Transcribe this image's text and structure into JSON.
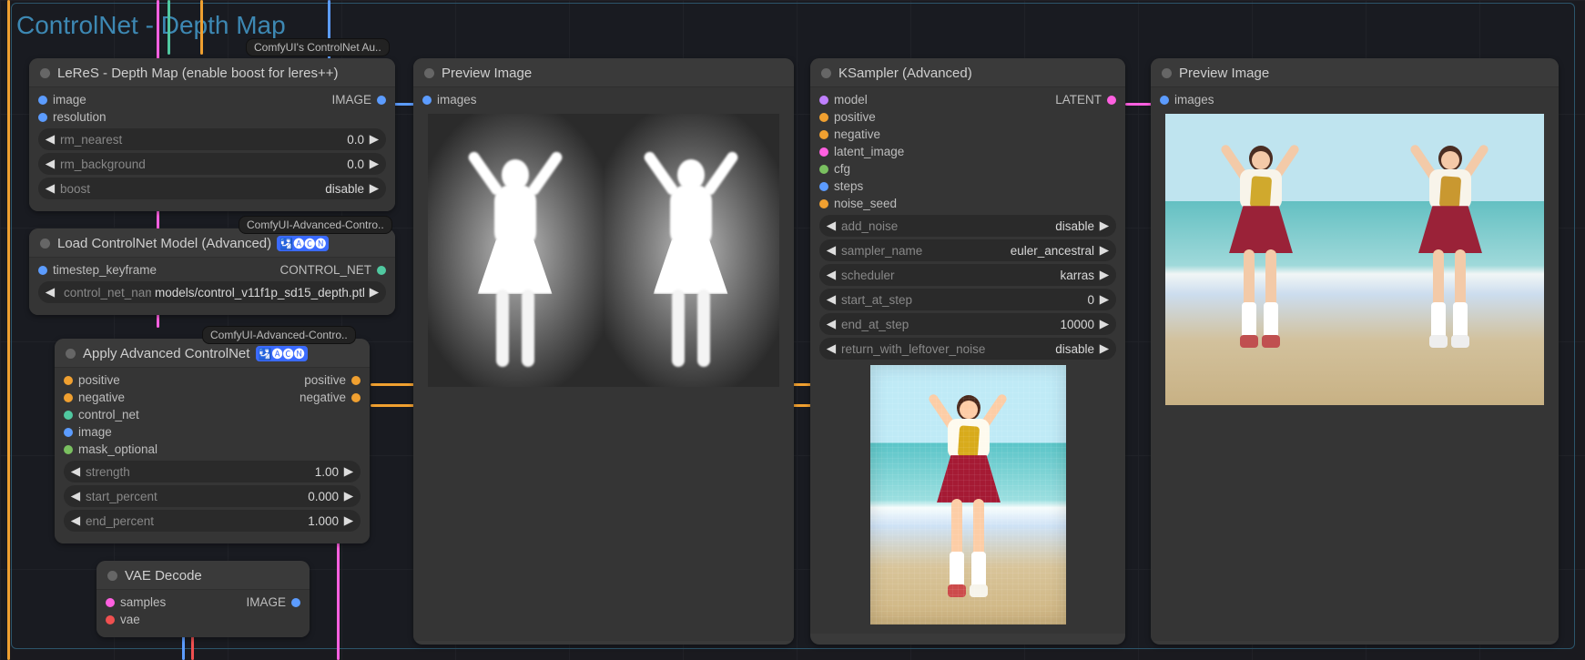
{
  "group": {
    "title": "ControlNet - Depth Map"
  },
  "badges": {
    "top": "ComfyUI's ControlNet Au..",
    "mid": "ComfyUI-Advanced-Contro..",
    "mid2": "ComfyUI-Advanced-Contro.."
  },
  "nodes": {
    "leres": {
      "title": "LeReS - Depth Map (enable boost for leres++)",
      "inputs": [
        {
          "name": "image",
          "color": "#5c9cff"
        },
        {
          "name": "resolution",
          "color": "#5c9cff"
        }
      ],
      "outputs": [
        {
          "name": "IMAGE",
          "color": "#5c9cff"
        }
      ],
      "widgets": [
        {
          "name": "rm_nearest",
          "value": "0.0"
        },
        {
          "name": "rm_background",
          "value": "0.0"
        },
        {
          "name": "boost",
          "value": "disable"
        }
      ]
    },
    "loadcn": {
      "title": "Load ControlNet Model (Advanced)",
      "title_extra": "🛂🅐🅒🅝",
      "inputs": [
        {
          "name": "timestep_keyframe",
          "color": "#5c9cff"
        }
      ],
      "outputs": [
        {
          "name": "CONTROL_NET",
          "color": "#50c8a0"
        }
      ],
      "widgets": [
        {
          "name": "control_net_name",
          "value": "models/control_v11f1p_sd15_depth.pth"
        }
      ]
    },
    "applycn": {
      "title": "Apply Advanced ControlNet",
      "title_extra": "🛂🅐🅒🅝",
      "inputs": [
        {
          "name": "positive",
          "color": "#f0a030"
        },
        {
          "name": "negative",
          "color": "#f0a030"
        },
        {
          "name": "control_net",
          "color": "#50c8a0"
        },
        {
          "name": "image",
          "color": "#5c9cff"
        },
        {
          "name": "mask_optional",
          "color": "#7ac060"
        }
      ],
      "outputs": [
        {
          "name": "positive",
          "color": "#f0a030"
        },
        {
          "name": "negative",
          "color": "#f0a030"
        }
      ],
      "widgets": [
        {
          "name": "strength",
          "value": "1.00"
        },
        {
          "name": "start_percent",
          "value": "0.000"
        },
        {
          "name": "end_percent",
          "value": "1.000"
        }
      ]
    },
    "vaedecode": {
      "title": "VAE Decode",
      "inputs": [
        {
          "name": "samples",
          "color": "#ff60e0"
        },
        {
          "name": "vae",
          "color": "#f05050"
        }
      ],
      "outputs": [
        {
          "name": "IMAGE",
          "color": "#5c9cff"
        }
      ]
    },
    "preview1": {
      "title": "Preview Image",
      "inputs": [
        {
          "name": "images",
          "color": "#5c9cff"
        }
      ]
    },
    "ksampler": {
      "title": "KSampler (Advanced)",
      "inputs": [
        {
          "name": "model",
          "color": "#c080ff"
        },
        {
          "name": "positive",
          "color": "#f0a030"
        },
        {
          "name": "negative",
          "color": "#f0a030"
        },
        {
          "name": "latent_image",
          "color": "#ff60e0"
        },
        {
          "name": "cfg",
          "color": "#7ac060"
        },
        {
          "name": "steps",
          "color": "#5c9cff"
        },
        {
          "name": "noise_seed",
          "color": "#f0a030"
        }
      ],
      "outputs": [
        {
          "name": "LATENT",
          "color": "#ff60e0"
        }
      ],
      "widgets": [
        {
          "name": "add_noise",
          "value": "disable"
        },
        {
          "name": "sampler_name",
          "value": "euler_ancestral"
        },
        {
          "name": "scheduler",
          "value": "karras"
        },
        {
          "name": "start_at_step",
          "value": "0"
        },
        {
          "name": "end_at_step",
          "value": "10000"
        },
        {
          "name": "return_with_leftover_noise",
          "value": "disable"
        }
      ]
    },
    "preview2": {
      "title": "Preview Image",
      "inputs": [
        {
          "name": "images",
          "color": "#5c9cff"
        }
      ]
    }
  }
}
